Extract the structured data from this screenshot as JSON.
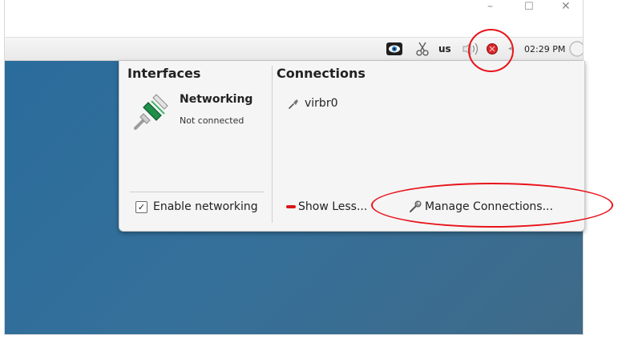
{
  "window_controls": {
    "minimize": "–",
    "maximize": "☐",
    "close": "✕"
  },
  "tray": {
    "keyboard_layout": "us",
    "clock": "02:29 PM",
    "icons": [
      "eye-icon",
      "scissors-icon",
      "speaker-icon",
      "network-status-icon",
      "expand-arrow-icon",
      "clock-icon"
    ]
  },
  "popup": {
    "interfaces_header": "Interfaces",
    "connections_header": "Connections",
    "interface": {
      "name": "Networking",
      "status": "Not connected"
    },
    "connections": [
      {
        "label": "virbr0"
      }
    ],
    "enable_networking_label": "Enable networking",
    "enable_networking_checked": true,
    "show_less_label": "Show Less...",
    "manage_connections_label": "Manage Connections..."
  },
  "colors": {
    "desktop_start": "#2a6c9c",
    "desktop_end": "#3f6a88",
    "annotation": "#e8141b",
    "popup_bg": "#f5f5f5"
  }
}
